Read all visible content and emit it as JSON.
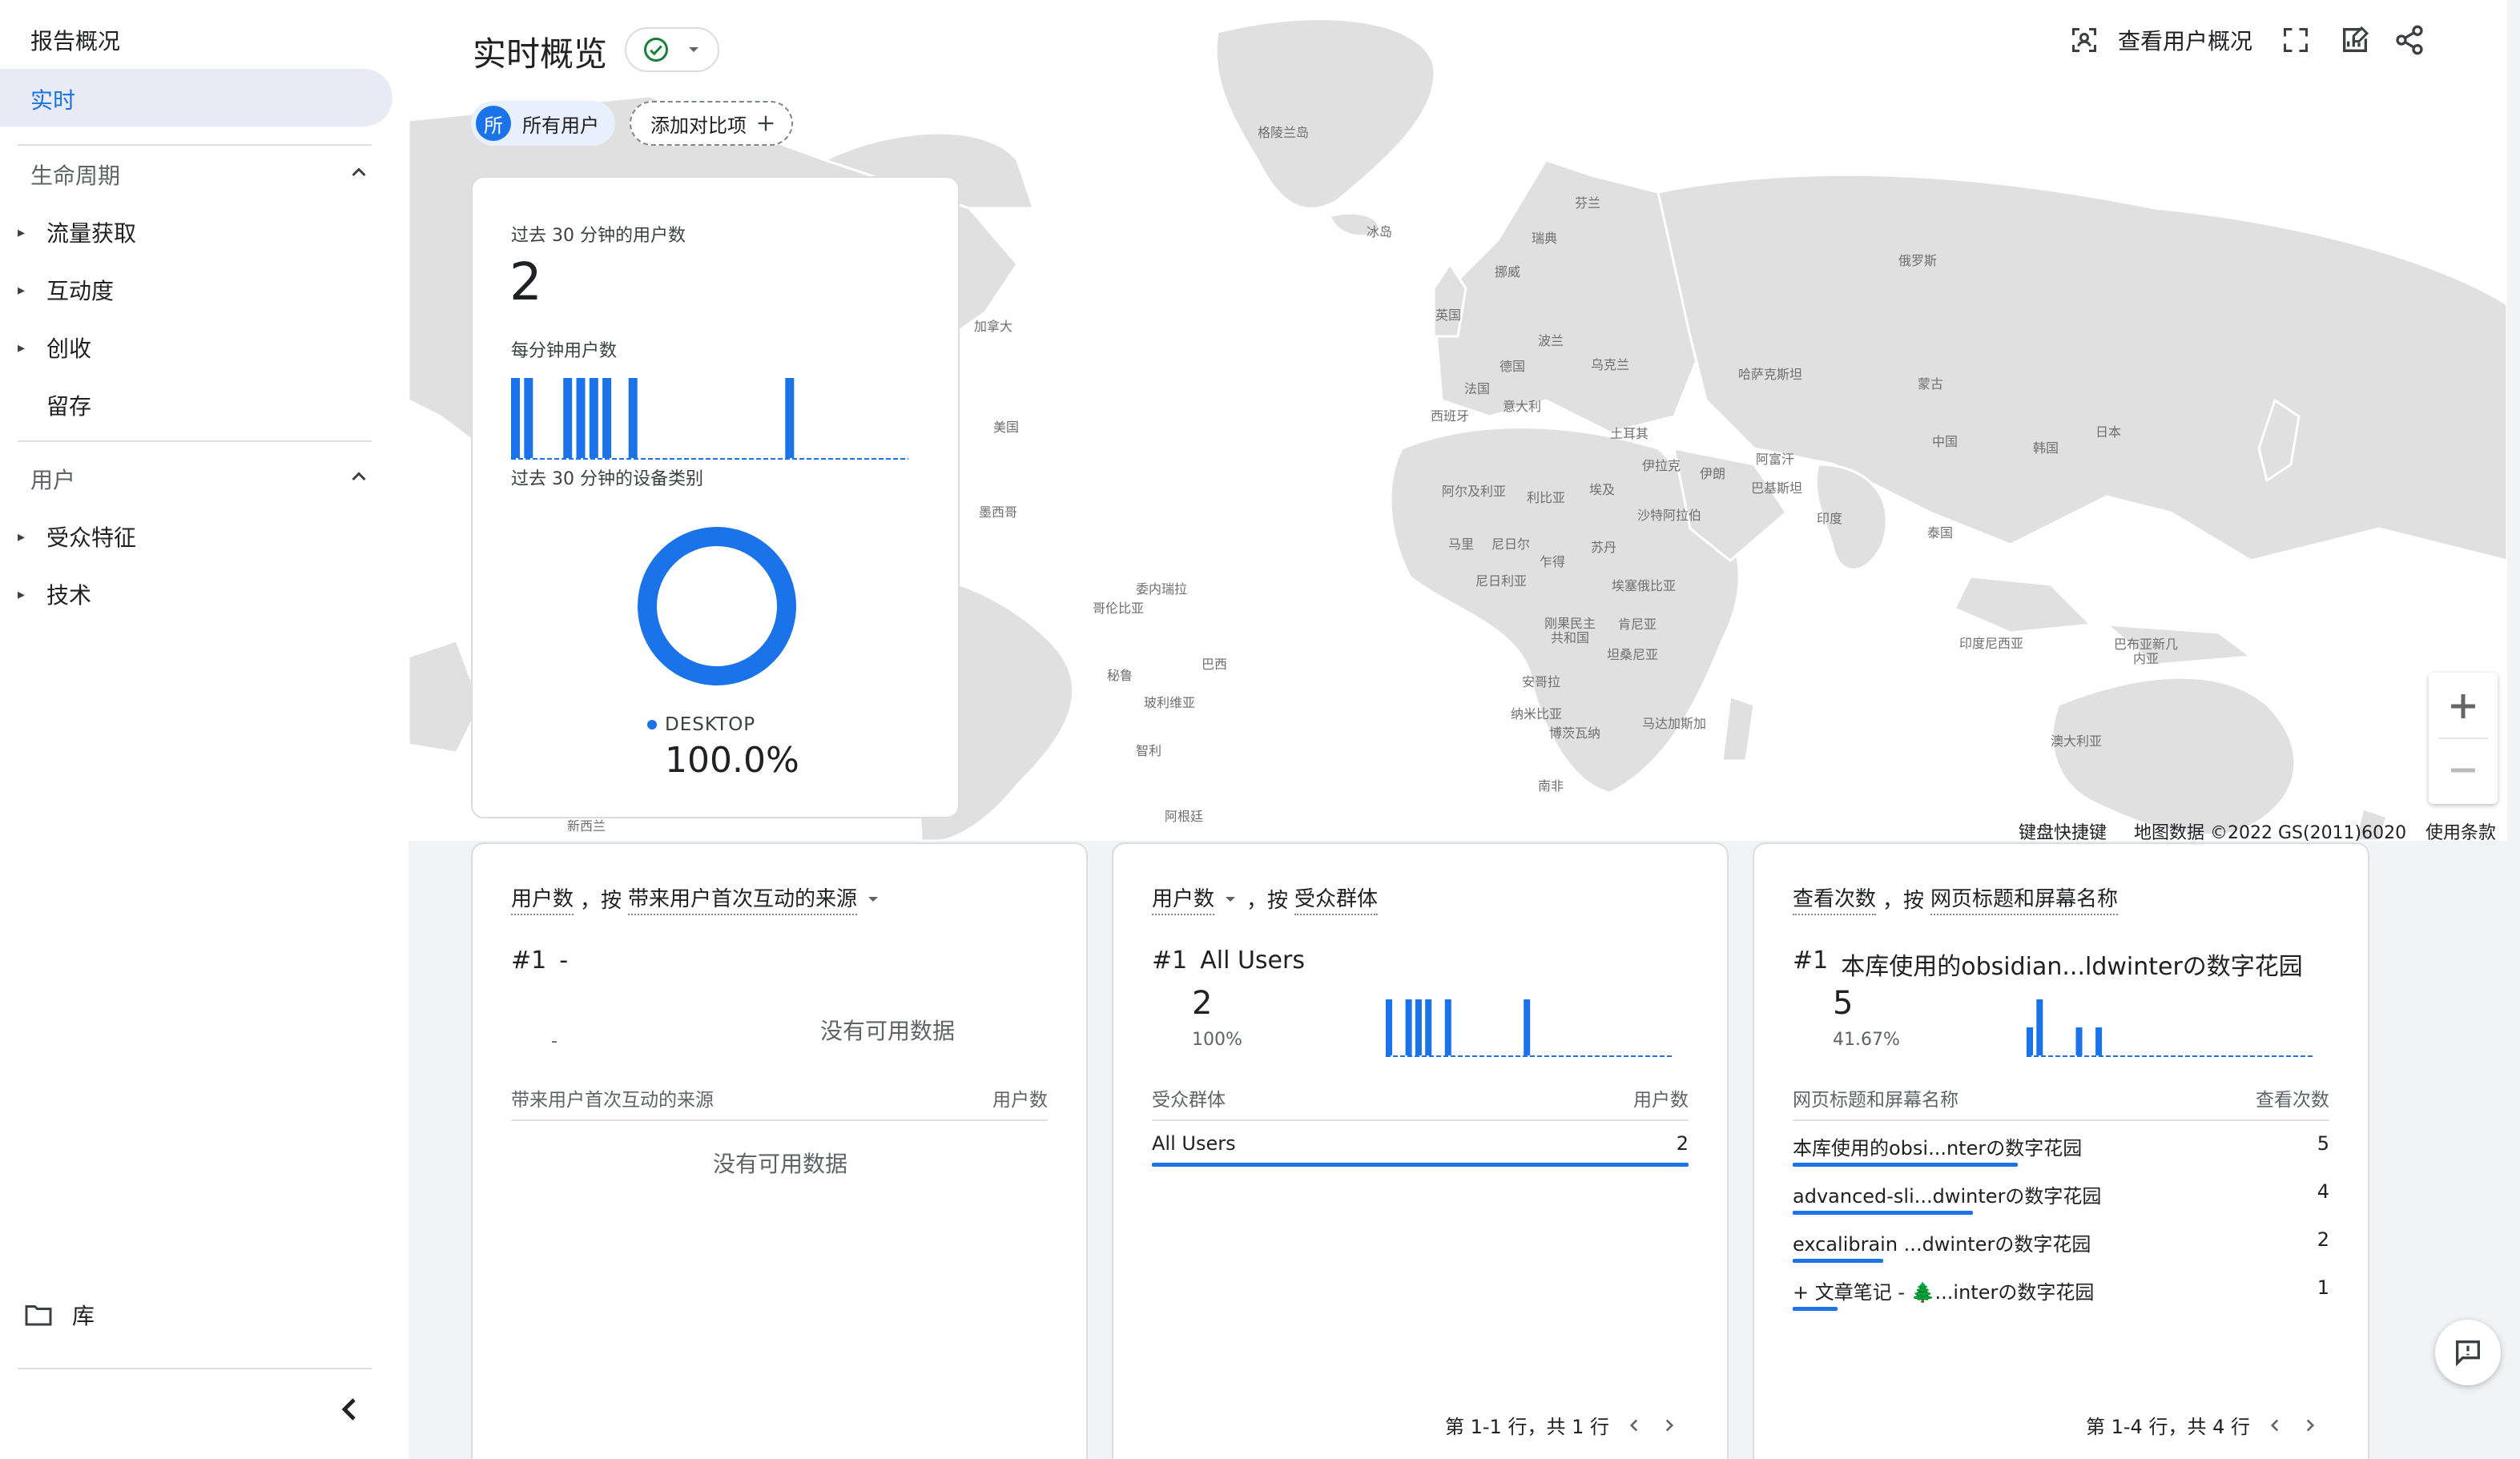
{
  "sidebar": {
    "title": "报告概况",
    "active_item": "实时",
    "lifecycle": {
      "label": "生命周期",
      "items": [
        "流量获取",
        "互动度",
        "创收",
        "留存"
      ]
    },
    "user": {
      "label": "用户",
      "items": [
        "受众特征",
        "技术"
      ]
    },
    "library": "库"
  },
  "header": {
    "title": "实时概览",
    "status_icon": "check-circle-icon",
    "chips": {
      "all_users": "所有用户",
      "avatar_letter": "所",
      "add_compare": "添加对比项"
    },
    "toolbar": {
      "view_users": "查看用户概况"
    }
  },
  "map": {
    "labels": [
      "格陵兰岛",
      "冰岛",
      "芬兰",
      "瑞典",
      "挪威",
      "俄罗斯",
      "加拿大",
      "英国",
      "波兰",
      "乌克兰",
      "哈萨克斯坦",
      "蒙古",
      "德国",
      "法国",
      "意大利",
      "西班牙",
      "土耳其",
      "中国",
      "日本",
      "韩国",
      "美国",
      "伊拉克",
      "伊朗",
      "阿富汗",
      "巴基斯坦",
      "阿尔及利亚",
      "利比亚",
      "埃及",
      "沙特阿拉伯",
      "印度",
      "泰国",
      "墨西哥",
      "马里",
      "尼日尔",
      "乍得",
      "苏丹",
      "尼日利亚",
      "埃塞俄比亚",
      "委内瑞拉",
      "哥伦比亚",
      "刚果民主共和国",
      "肯尼亚",
      "坦桑尼亚",
      "印度尼西亚",
      "巴布亚新几内亚",
      "巴西",
      "秘鲁",
      "玻利维亚",
      "安哥拉",
      "纳米比亚",
      "博茨瓦纳",
      "马达加斯加",
      "智利",
      "澳大利亚",
      "南非",
      "阿根廷",
      "新西兰"
    ],
    "attribution": {
      "shortcuts": "键盘快捷键",
      "data": "地图数据 ©2022 GS(2011)6020",
      "terms": "使用条款"
    }
  },
  "summary_card": {
    "users_label": "过去 30 分钟的用户数",
    "users_value": "2",
    "per_minute_label": "每分钟用户数",
    "per_minute_values": [
      1,
      1,
      0,
      0,
      1,
      1,
      1,
      1,
      0,
      1,
      0,
      0,
      0,
      0,
      0,
      0,
      0,
      0,
      0,
      0,
      0,
      1,
      0,
      0,
      0,
      0,
      0,
      0,
      0,
      0
    ],
    "device_label": "过去 30 分钟的设备类别",
    "device_legend": "DESKTOP",
    "device_percent": "100.0%",
    "device_fraction": 1.0
  },
  "card_source": {
    "title_metric": "用户数",
    "title_sep": "，按",
    "title_dim": "带来用户首次互动的来源",
    "rank": "#1",
    "rank_value": "-",
    "spark_label": "-",
    "no_data_chart": "没有可用数据",
    "col_left": "带来用户首次互动的来源",
    "col_right": "用户数",
    "no_data_table": "没有可用数据"
  },
  "card_audience": {
    "title_metric": "用户数",
    "title_sep": "，按",
    "title_dim": "受众群体",
    "rank": "#1",
    "rank_value": "All Users",
    "metric_value": "2",
    "metric_pct": "100%",
    "spark_values": [
      1,
      0,
      1,
      1,
      1,
      0,
      1,
      0,
      0,
      0,
      0,
      0,
      0,
      0,
      1,
      0,
      0,
      0,
      0,
      0,
      0,
      0,
      0,
      0,
      0,
      0,
      0,
      0,
      0,
      0
    ],
    "col_left": "受众群体",
    "col_right": "用户数",
    "rows": [
      {
        "label": "All Users",
        "value": "2",
        "share": 1.0
      }
    ],
    "pager": "第 1-1 行，共 1 行"
  },
  "card_pages": {
    "title_metric": "查看次数",
    "title_sep": "，按",
    "title_dim": "网页标题和屏幕名称",
    "rank": "#1",
    "rank_value": "本库使用的obsidian...ldwinterの数字花园",
    "metric_value": "5",
    "metric_pct": "41.67%",
    "spark_values": [
      1,
      2,
      0,
      0,
      0,
      1,
      0,
      1,
      0,
      0,
      0,
      0,
      0,
      0,
      0,
      0,
      0,
      0,
      0,
      0,
      0,
      0,
      0,
      0,
      0,
      0,
      0,
      0,
      0,
      0
    ],
    "col_left": "网页标题和屏幕名称",
    "col_right": "查看次数",
    "rows": [
      {
        "label": "本库使用的obsi...nterの数字花园",
        "value": "5",
        "share": 1.0
      },
      {
        "label": "advanced-sli...dwinterの数字花园",
        "value": "4",
        "share": 0.8
      },
      {
        "label": "excalibrain ...dwinterの数字花园",
        "value": "2",
        "share": 0.4
      },
      {
        "label": "+ 文章笔记 - 🌲...interの数字花园",
        "value": "1",
        "share": 0.2
      }
    ],
    "pager": "第 1-4 行，共 4 行"
  },
  "colors": {
    "accent": "#1a73e8",
    "success": "#188038"
  }
}
